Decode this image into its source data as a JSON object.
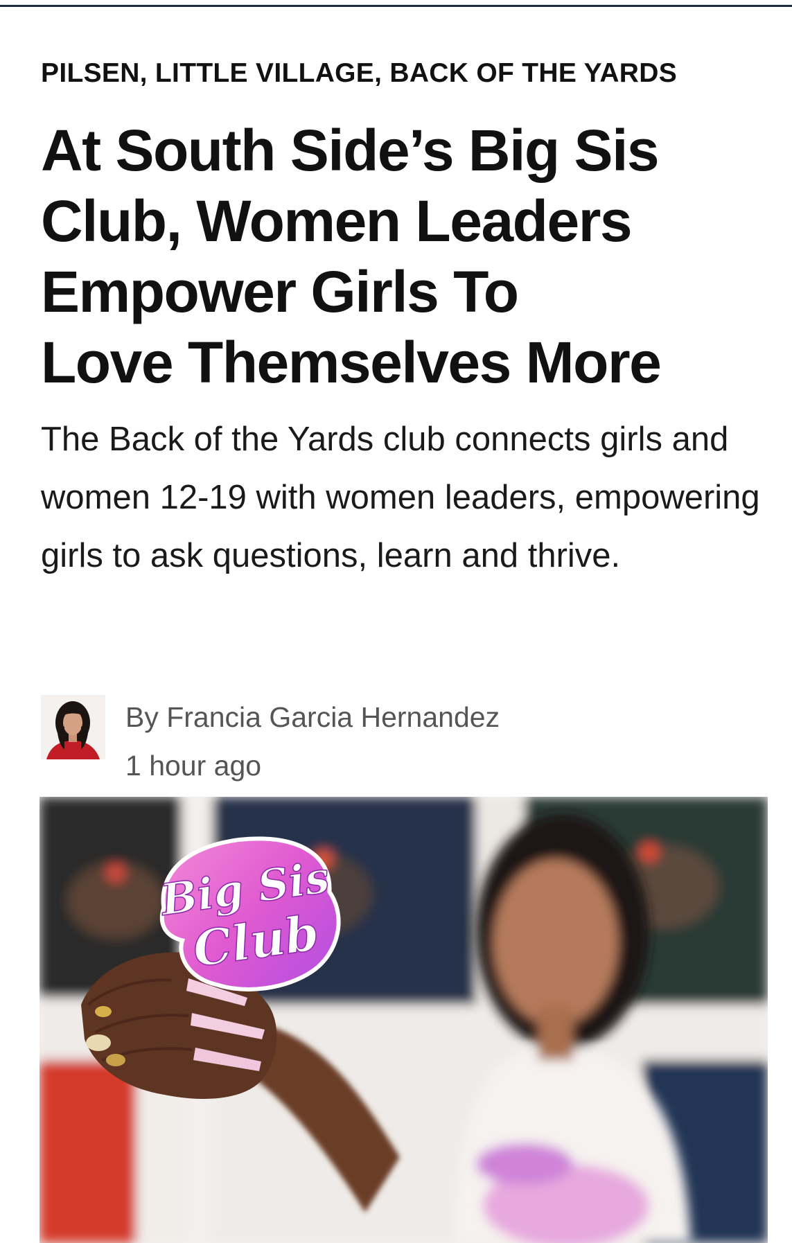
{
  "article": {
    "category": "PILSEN, LITTLE VILLAGE, BACK OF THE YARDS",
    "headline": "At South Side’s Big Sis Club, Women Leaders Empower Girls To Love Themselves More",
    "dek": "The Back of the Yards club connects girls and women 12-19 with women leaders, empowering girls to ask questions, learn and thrive.",
    "byline": {
      "author": "By Francia Garcia Hernandez",
      "timestamp": "1 hour ago"
    },
    "hero_image": {
      "sticker_line1": "Big Sis",
      "sticker_line2": "Club"
    }
  },
  "colors": {
    "text": "#111111",
    "muted": "#555555",
    "top_rule": "#1f2a40",
    "sticker_pink": "#e85bd0",
    "sticker_purple": "#b34de0"
  }
}
